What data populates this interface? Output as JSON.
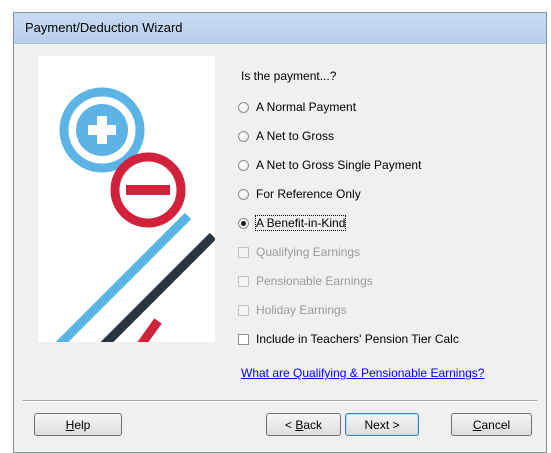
{
  "window": {
    "title": "Payment/Deduction Wizard"
  },
  "question": "Is the payment...?",
  "payment_options": [
    {
      "label": "A Normal Payment",
      "checked": false
    },
    {
      "label": "A Net to Gross",
      "checked": false
    },
    {
      "label": "A Net to Gross Single Payment",
      "checked": false
    },
    {
      "label": "For Reference Only",
      "checked": false
    },
    {
      "label": "A Benefit-in-Kind",
      "checked": true
    }
  ],
  "checkboxes": [
    {
      "label": "Qualifying Earnings",
      "checked": false,
      "enabled": false
    },
    {
      "label": "Pensionable Earnings",
      "checked": false,
      "enabled": false
    },
    {
      "label": "Holiday Earnings",
      "checked": false,
      "enabled": false
    },
    {
      "label": "Include in Teachers' Pension Tier Calc",
      "checked": false,
      "enabled": true
    }
  ],
  "help_link": "What are Qualifying & Pensionable Earnings?",
  "buttons": {
    "help": {
      "pre": "",
      "mnemonic": "H",
      "post": "elp"
    },
    "back": {
      "pre": "< ",
      "mnemonic": "B",
      "post": "ack"
    },
    "next": "Next >",
    "cancel": {
      "pre": "",
      "mnemonic": "C",
      "post": "ancel"
    }
  },
  "colors": {
    "plus_blue": "#5bb4e5",
    "minus_red": "#d2213a",
    "stripe_dark": "#2b3540"
  }
}
